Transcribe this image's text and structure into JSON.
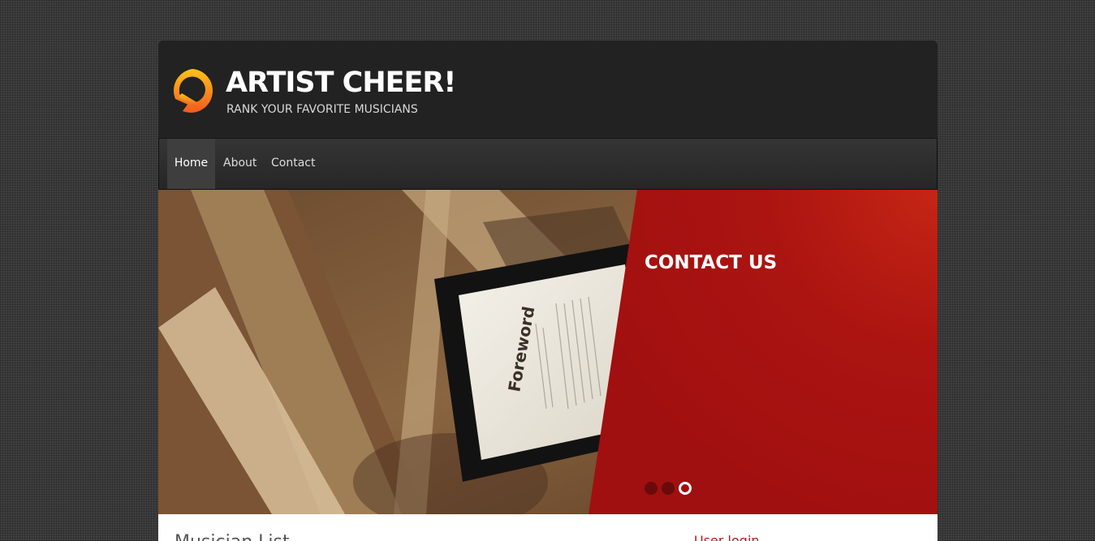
{
  "header": {
    "site_name": "ARTIST CHEER!",
    "slogan": "RANK YOUR FAVORITE MUSICIANS",
    "logo_icon": "orange-ring-logo-icon"
  },
  "nav": {
    "items": [
      {
        "label": "Home",
        "active": true
      },
      {
        "label": "About",
        "active": false
      },
      {
        "label": "Contact",
        "active": false
      }
    ]
  },
  "slideshow": {
    "title": "CONTACT US",
    "image_text": {
      "heading": "Foreword"
    },
    "slide_count": 3,
    "active_slide": 3
  },
  "main": {
    "heading": "Musician List"
  },
  "sidebar": {
    "block_title": "User login"
  },
  "colors": {
    "accent_red": "#a81412",
    "header_bg": "#222222",
    "logo_orange": "#f7941d"
  }
}
